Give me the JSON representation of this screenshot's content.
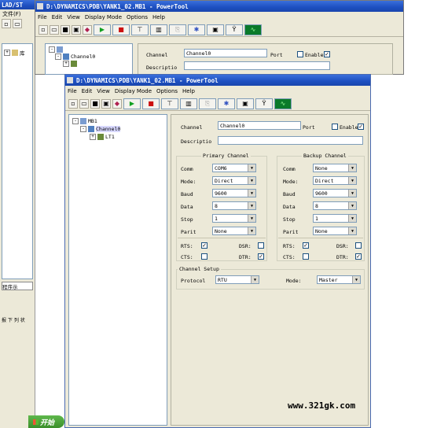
{
  "back_window": {
    "title": "D:\\DYNAMICS\\PDB\\YANK1_02.MB1 - PowerTool",
    "left_title": "LAD/ST",
    "left_menu": "文件(F)",
    "menu": [
      "File",
      "Edit",
      "View",
      "Display Mode",
      "Options",
      "Help"
    ],
    "channel_label": "Channel",
    "channel_value": "Channel0",
    "port_label": "Port",
    "enable_label": "Enable",
    "description_label": "Descriptio",
    "left_item_lib": "库",
    "left_tab": "程序示",
    "left_status": "报 下 列 状"
  },
  "front_window": {
    "title": "D:\\DYNAMICS\\PDB\\YANK1_02.MB1 - PowerTool",
    "menu": [
      "File",
      "Edit",
      "View",
      "Display Mode",
      "Options",
      "Help"
    ],
    "tree": {
      "root": "MB1",
      "channel": "Channel0",
      "lt": "LT1"
    },
    "form": {
      "channel_label": "Channel",
      "channel_value": "Channel0",
      "port_label": "Port",
      "enable_label": "Enable",
      "enable_checked": true,
      "description_label": "Descriptio",
      "description_value": ""
    },
    "primary": {
      "title": "Primary Channel",
      "rows": [
        {
          "label": "Comm",
          "value": "COM6"
        },
        {
          "label": "Mode:",
          "value": "Direct"
        },
        {
          "label": "Baud",
          "value": "9600"
        },
        {
          "label": "Data",
          "value": "8"
        },
        {
          "label": "Stop",
          "value": "1"
        },
        {
          "label": "Parit",
          "value": "None"
        }
      ],
      "rts_label": "RTS:",
      "rts": true,
      "dsr_label": "DSR:",
      "dsr": false,
      "cts_label": "CTS:",
      "cts": false,
      "dtr_label": "DTR:",
      "dtr": true
    },
    "backup": {
      "title": "Backup Channel",
      "rows": [
        {
          "label": "Comm",
          "value": "None"
        },
        {
          "label": "Mode:",
          "value": "Direct"
        },
        {
          "label": "Baud",
          "value": "9600"
        },
        {
          "label": "Data",
          "value": "8"
        },
        {
          "label": "Stop",
          "value": "1"
        },
        {
          "label": "Parit",
          "value": "None"
        }
      ],
      "rts_label": "RTS:",
      "rts": true,
      "dsr_label": "DSR:",
      "dsr": false,
      "cts_label": "CTS:",
      "cts": false,
      "dtr_label": "DTR:",
      "dtr": true
    },
    "setup": {
      "title": "Channel Setup",
      "protocol_label": "Protocol",
      "protocol_value": "RTU",
      "mode_label": "Mode:",
      "mode_value": "Master"
    }
  },
  "start_button": "开始",
  "watermark": "www.321gk.com",
  "colors": {
    "accent": "#1d4fc0",
    "play": "#10a020",
    "stop": "#cc1010",
    "panel": "#ece9d8"
  }
}
